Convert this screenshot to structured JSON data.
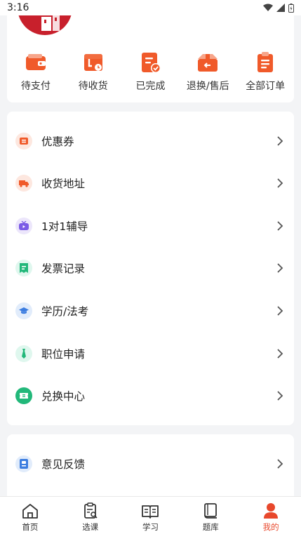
{
  "status_bar": {
    "time": "3:16"
  },
  "orders": [
    {
      "label": "待支付",
      "icon": "wallet-icon"
    },
    {
      "label": "待收货",
      "icon": "delivery-box-icon"
    },
    {
      "label": "已完成",
      "icon": "document-check-icon"
    },
    {
      "label": "退换/售后",
      "icon": "return-box-icon"
    },
    {
      "label": "全部订单",
      "icon": "clipboard-list-icon"
    }
  ],
  "menu": [
    {
      "label": "优惠券",
      "icon": "coupon-icon"
    },
    {
      "label": "收货地址",
      "icon": "truck-icon"
    },
    {
      "label": "1对1辅导",
      "icon": "tv-tutor-icon"
    },
    {
      "label": "发票记录",
      "icon": "invoice-icon"
    },
    {
      "label": "学历/法考",
      "icon": "graduation-cap-icon"
    },
    {
      "label": "职位申请",
      "icon": "tie-icon"
    },
    {
      "label": "兑换中心",
      "icon": "ticket-icon"
    }
  ],
  "menu2": [
    {
      "label": "意见反馈",
      "icon": "feedback-icon"
    }
  ],
  "tabbar": [
    {
      "label": "首页",
      "icon": "home-icon",
      "active": false
    },
    {
      "label": "选课",
      "icon": "course-select-icon",
      "active": false
    },
    {
      "label": "学习",
      "icon": "open-book-icon",
      "active": false
    },
    {
      "label": "题库",
      "icon": "question-bank-icon",
      "active": false
    },
    {
      "label": "我的",
      "icon": "person-icon",
      "active": true
    }
  ],
  "colors": {
    "accent": "#f05a2a",
    "active_tab": "#e8482c",
    "background": "#f3f4f6"
  }
}
